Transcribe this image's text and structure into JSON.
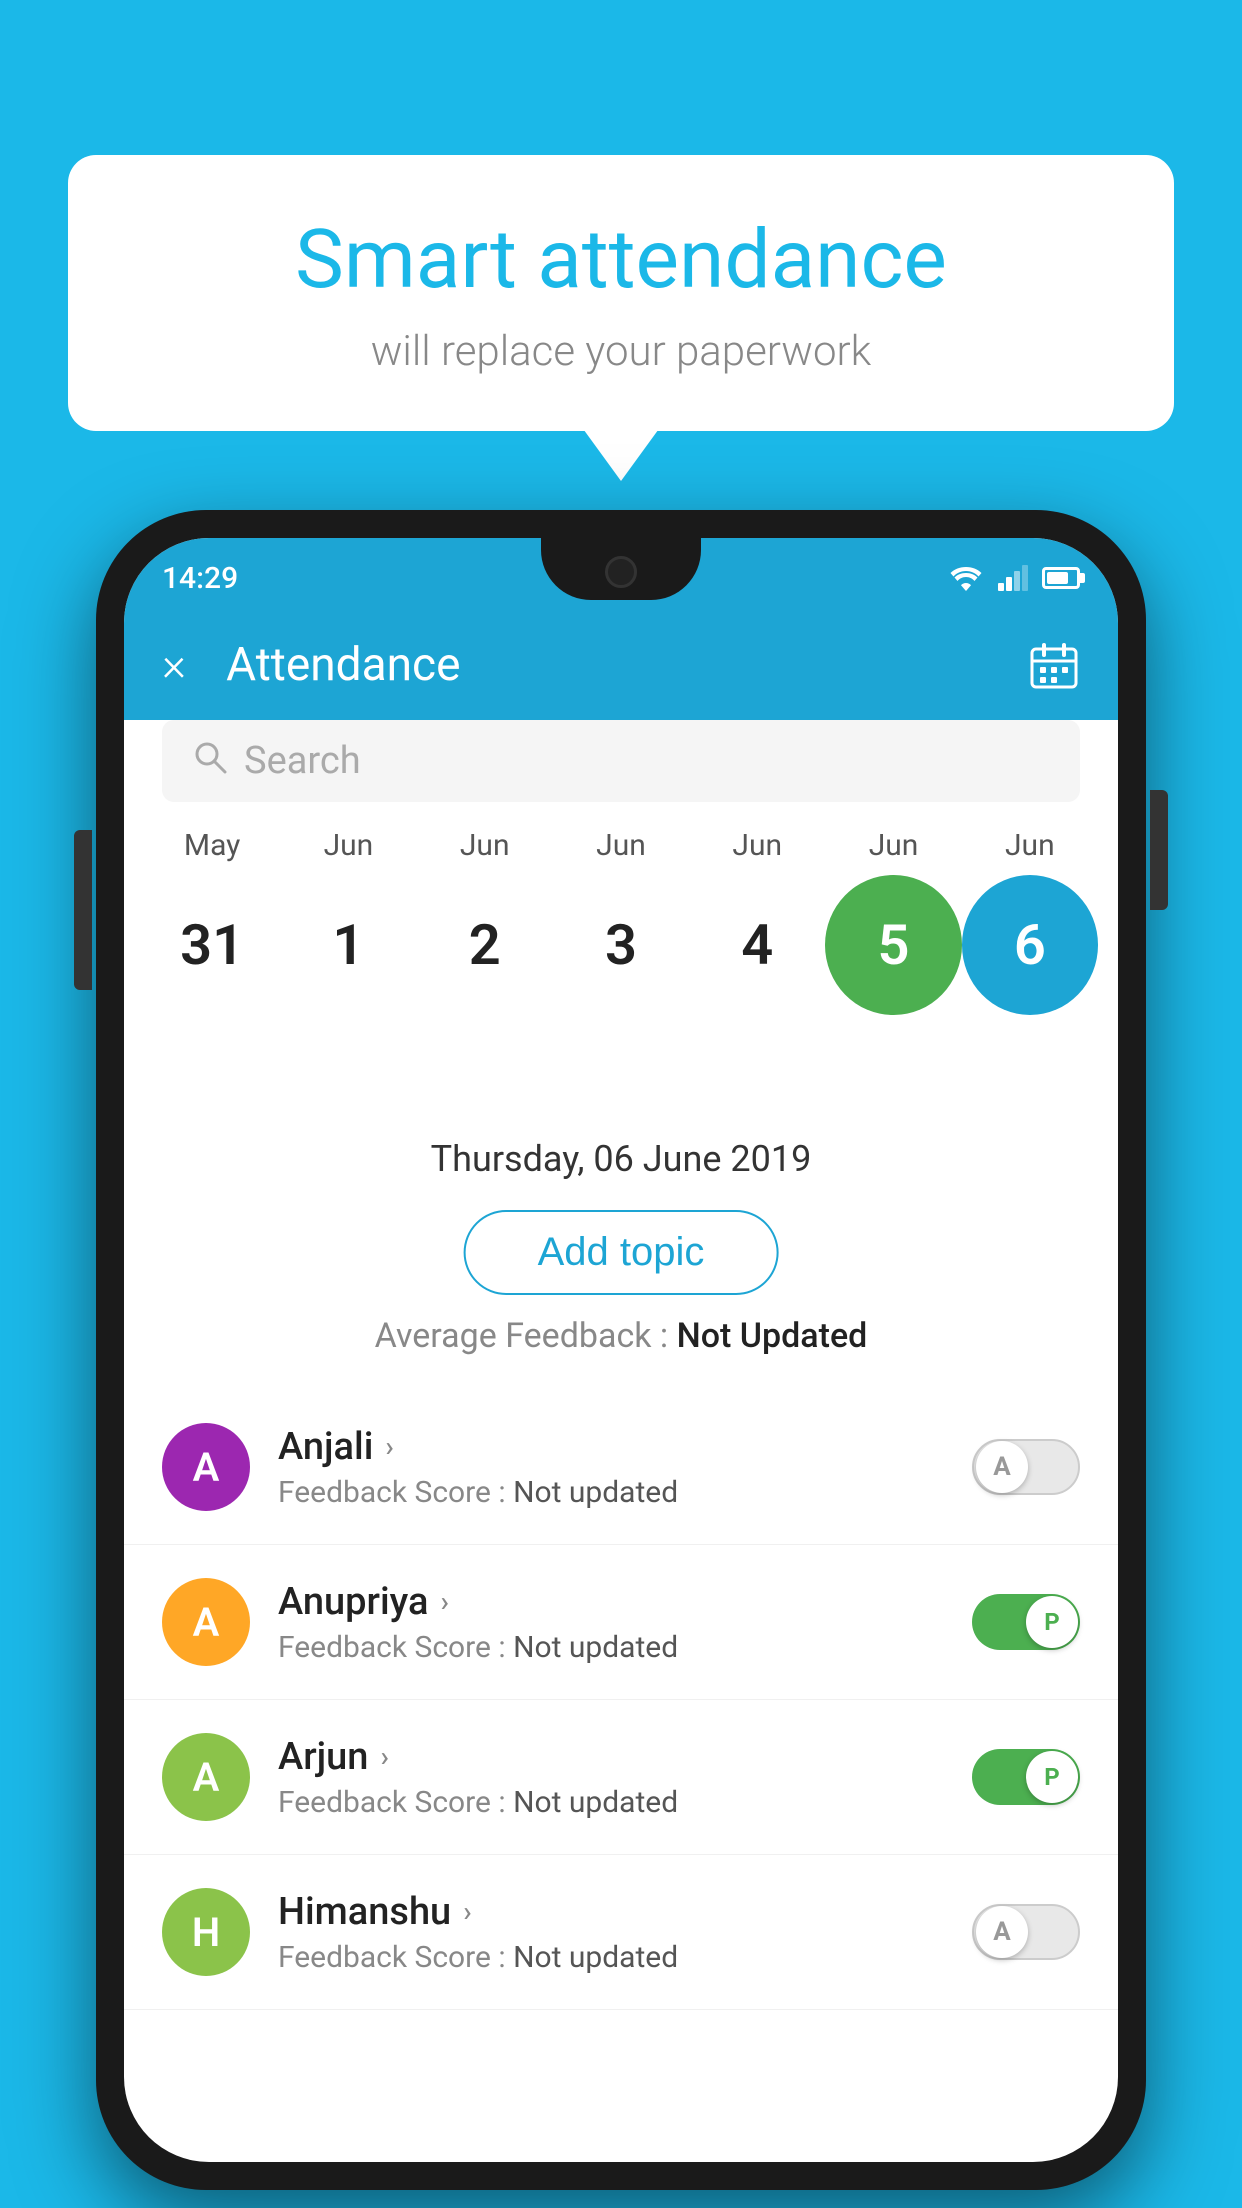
{
  "background_color": "#1bb8e8",
  "speech_bubble": {
    "title": "Smart attendance",
    "subtitle": "will replace your paperwork"
  },
  "status_bar": {
    "time": "14:29"
  },
  "app_bar": {
    "title": "Attendance",
    "close_icon": "×",
    "calendar_icon": "📅"
  },
  "search": {
    "placeholder": "Search"
  },
  "calendar": {
    "months": [
      "May",
      "Jun",
      "Jun",
      "Jun",
      "Jun",
      "Jun",
      "Jun"
    ],
    "dates": [
      "31",
      "1",
      "2",
      "3",
      "4",
      "5",
      "6"
    ],
    "today_index": 5,
    "selected_index": 6
  },
  "selected_date": "Thursday, 06 June 2019",
  "add_topic_label": "Add topic",
  "avg_feedback": {
    "label": "Average Feedback : ",
    "value": "Not Updated"
  },
  "students": [
    {
      "name": "Anjali",
      "avatar_letter": "A",
      "avatar_color": "#9c27b0",
      "feedback_label": "Feedback Score : ",
      "feedback_value": "Not updated",
      "toggle_state": "off",
      "toggle_label": "A"
    },
    {
      "name": "Anupriya",
      "avatar_letter": "A",
      "avatar_color": "#ffa726",
      "feedback_label": "Feedback Score : ",
      "feedback_value": "Not updated",
      "toggle_state": "on-present",
      "toggle_label": "P"
    },
    {
      "name": "Arjun",
      "avatar_letter": "A",
      "avatar_color": "#8bc34a",
      "feedback_label": "Feedback Score : ",
      "feedback_value": "Not updated",
      "toggle_state": "on-present",
      "toggle_label": "P"
    },
    {
      "name": "Himanshu",
      "avatar_letter": "H",
      "avatar_color": "#8bc34a",
      "feedback_label": "Feedback Score : ",
      "feedback_value": "Not updated",
      "toggle_state": "off",
      "toggle_label": "A"
    }
  ]
}
